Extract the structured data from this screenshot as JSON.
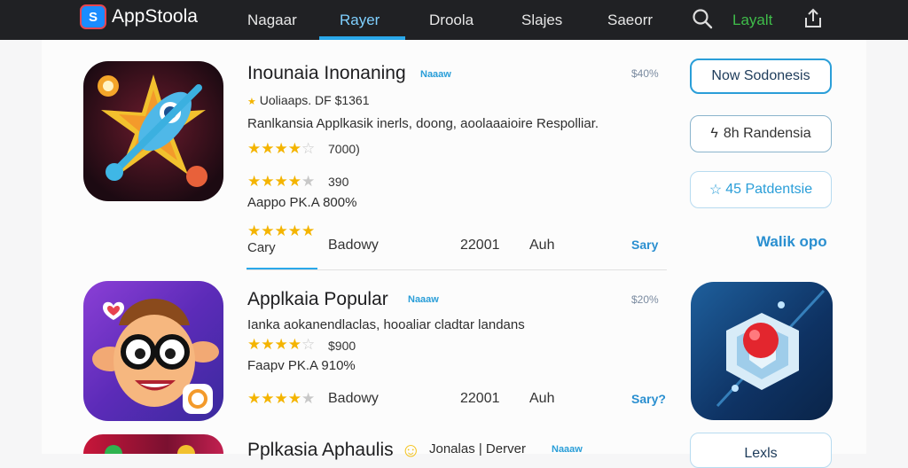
{
  "header": {
    "logo_icon_letter": "S",
    "logo_text": "AppStoola",
    "nav": [
      "Nagaar",
      "Rayer",
      "Droola",
      "Slajes",
      "Saeorr"
    ],
    "active_nav": "Rayer",
    "layalt_label": "Layalt",
    "icons": [
      "search-icon",
      "share-icon"
    ]
  },
  "apps": [
    {
      "title": "Inounaia Inonaning",
      "badge": "Naaaw",
      "price": "$40%",
      "developer": "Uoliaaps. DF $1361",
      "description": "Ranlkansia Applkasik inerls, doong, aoolaaaioire Respolliar.",
      "ratings": [
        {
          "stars": 4,
          "text": "7000)"
        },
        {
          "stars": 4,
          "text": "390"
        }
      ],
      "age_line": "Aappo PK.A 800%",
      "category_rating": 5,
      "category_label": "Cary",
      "meta": [
        "Badowy",
        "22001",
        "Auh"
      ],
      "link": "Sary"
    },
    {
      "title": "Applkaia Popular",
      "badge": "Naaaw",
      "price": "$20%",
      "description": "Ianka aokanendlaclas, hooaliar cladtar landans",
      "ratings": [
        {
          "stars": 4,
          "text": "$900"
        }
      ],
      "age_line": "Faapv PK.A 910%",
      "category_rating": 4,
      "meta": [
        "Badowy",
        "22001",
        "Auh"
      ],
      "link": "Sary?"
    },
    {
      "title": "Pplkasia Aphaulis",
      "badge": "Naaaw",
      "extra": "Jonalas | Derver"
    }
  ],
  "sidebar": {
    "primary_button": "Now Sodonesis",
    "secondary_button": "8h Randensia",
    "tertiary_button": "45 Patdentsie",
    "walk_link": "Walik opo",
    "bottom_button": "Lexls"
  },
  "colors": {
    "topbar": "#202124",
    "accent": "#2aa8ea",
    "star": "#f4b400",
    "layalt": "#3fbd4a"
  }
}
